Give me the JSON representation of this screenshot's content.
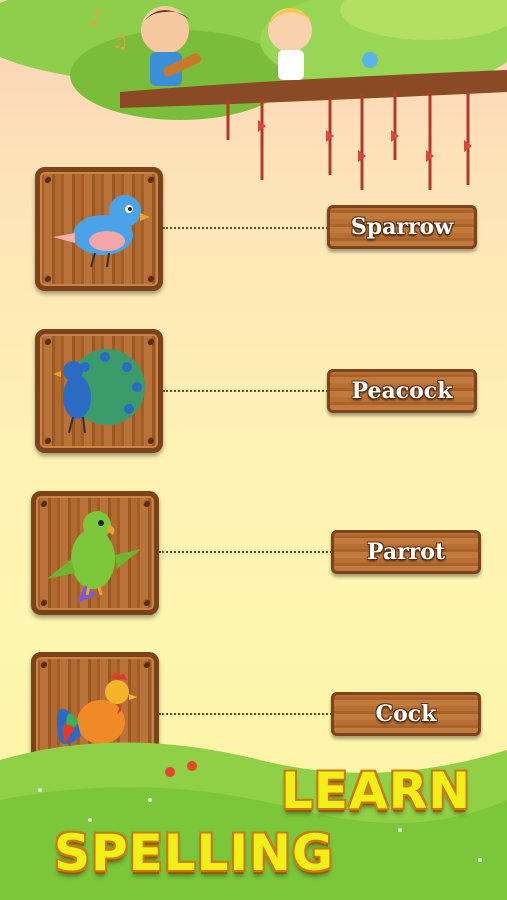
{
  "game": {
    "title_line1": "LEARN",
    "title_line2": "SPELLING"
  },
  "items": [
    {
      "picture": "sparrow-icon",
      "word": "Sparrow"
    },
    {
      "picture": "peacock-icon",
      "word": "Peacock"
    },
    {
      "picture": "parrot-icon",
      "word": "Parrot"
    },
    {
      "picture": "cock-icon",
      "word": "Cock"
    }
  ],
  "colors": {
    "title_fill": "#f2ef18",
    "plank_wood": "#b86f33",
    "grass": "#7bc63a"
  }
}
